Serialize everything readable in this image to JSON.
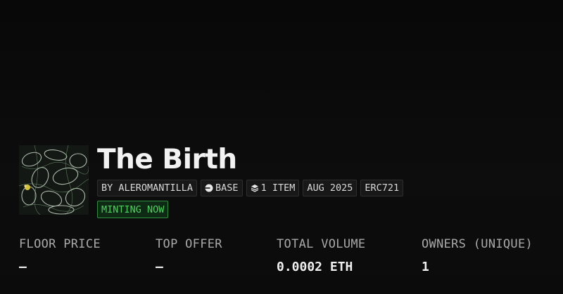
{
  "collection": {
    "title": "The Birth",
    "image_alt": "",
    "tags": {
      "creator": "BY ALEROMANTILLA",
      "chain": "BASE",
      "items": "1 ITEM",
      "date": "AUG 2025",
      "standard": "ERC721"
    },
    "chain_icon": "base-chain-icon",
    "items_icon": "layers-icon",
    "status": "MINTING NOW",
    "status_color": "#4fd060"
  },
  "stats": [
    {
      "label": "FLOOR PRICE",
      "value": "—"
    },
    {
      "label": "TOP OFFER",
      "value": "—"
    },
    {
      "label": "TOTAL VOLUME",
      "value": "0.0002 ETH"
    },
    {
      "label": "OWNERS (UNIQUE)",
      "value": "1"
    }
  ]
}
